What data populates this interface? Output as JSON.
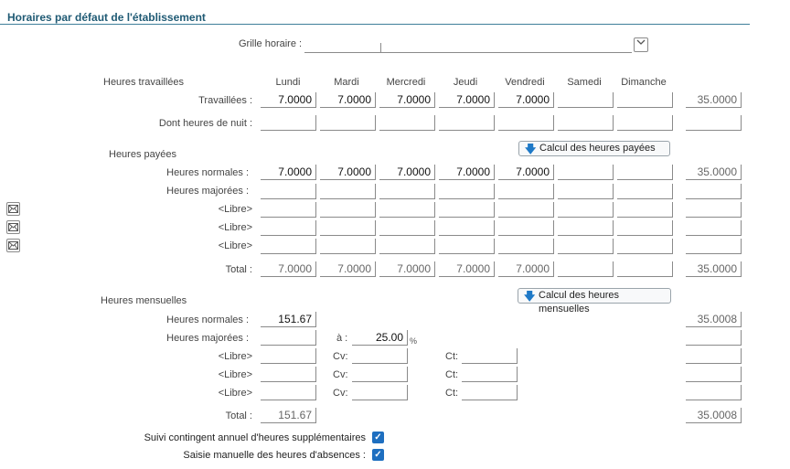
{
  "page_title": "Horaires par défaut de l'établissement",
  "grille": {
    "label": "Grille horaire :",
    "value": ""
  },
  "days": [
    "Lundi",
    "Mardi",
    "Mercredi",
    "Jeudi",
    "Vendredi",
    "Samedi",
    "Dimanche"
  ],
  "section_worked": {
    "label": "Heures travaillées",
    "rows": [
      {
        "label": "Travaillées :",
        "values": [
          "7.0000",
          "7.0000",
          "7.0000",
          "7.0000",
          "7.0000",
          "",
          ""
        ],
        "total": "35.0000"
      },
      {
        "label": "Dont heures de nuit :",
        "values": [
          "",
          "",
          "",
          "",
          "",
          "",
          ""
        ],
        "total": ""
      }
    ]
  },
  "section_paid": {
    "label": "Heures payées",
    "button": "Calcul des heures payées",
    "rows": [
      {
        "label": "Heures normales :",
        "values": [
          "7.0000",
          "7.0000",
          "7.0000",
          "7.0000",
          "7.0000",
          "",
          ""
        ],
        "total": "35.0000"
      },
      {
        "label": "Heures majorées :",
        "values": [
          "",
          "",
          "",
          "",
          "",
          "",
          ""
        ],
        "total": ""
      },
      {
        "label": "<Libre>",
        "values": [
          "",
          "",
          "",
          "",
          "",
          "",
          ""
        ],
        "total": ""
      },
      {
        "label": "<Libre>",
        "values": [
          "",
          "",
          "",
          "",
          "",
          "",
          ""
        ],
        "total": ""
      },
      {
        "label": "<Libre>",
        "values": [
          "",
          "",
          "",
          "",
          "",
          "",
          ""
        ],
        "total": ""
      },
      {
        "label": "Total :",
        "values": [
          "7.0000",
          "7.0000",
          "7.0000",
          "7.0000",
          "7.0000",
          "",
          ""
        ],
        "total": "35.0000"
      }
    ]
  },
  "section_monthly": {
    "label": "Heures mensuelles",
    "button": "Calcul des heures mensuelles",
    "normales": {
      "label": "Heures normales :",
      "value": "151.67",
      "total": "35.0008"
    },
    "majorees": {
      "label": "Heures majorées :",
      "value": "",
      "a_label": "à :",
      "rate": "25.00",
      "pct": "%",
      "total": ""
    },
    "libres": [
      {
        "label": "<Libre>",
        "cv_label": "Cv:",
        "cv": "",
        "ct_label": "Ct:",
        "ct": "",
        "total": ""
      },
      {
        "label": "<Libre>",
        "cv_label": "Cv:",
        "cv": "",
        "ct_label": "Ct:",
        "ct": "",
        "total": ""
      },
      {
        "label": "<Libre>",
        "cv_label": "Cv:",
        "cv": "",
        "ct_label": "Ct:",
        "ct": "",
        "total": ""
      }
    ],
    "total": {
      "label": "Total :",
      "value": "151.67",
      "total": "35.0008"
    }
  },
  "checkboxes": [
    {
      "label": "Suivi contingent annuel d'heures supplémentaires",
      "checked": true
    },
    {
      "label": "Saisie manuelle des heures d'absences :",
      "checked": true
    }
  ],
  "icons": {
    "mail": "envelope-icon",
    "combo": "chevron-down-icon",
    "arrow": "arrow-down-icon",
    "check": "checkmark-icon"
  },
  "colors": {
    "title": "#1f5a74",
    "accent": "#1e6fc0"
  }
}
